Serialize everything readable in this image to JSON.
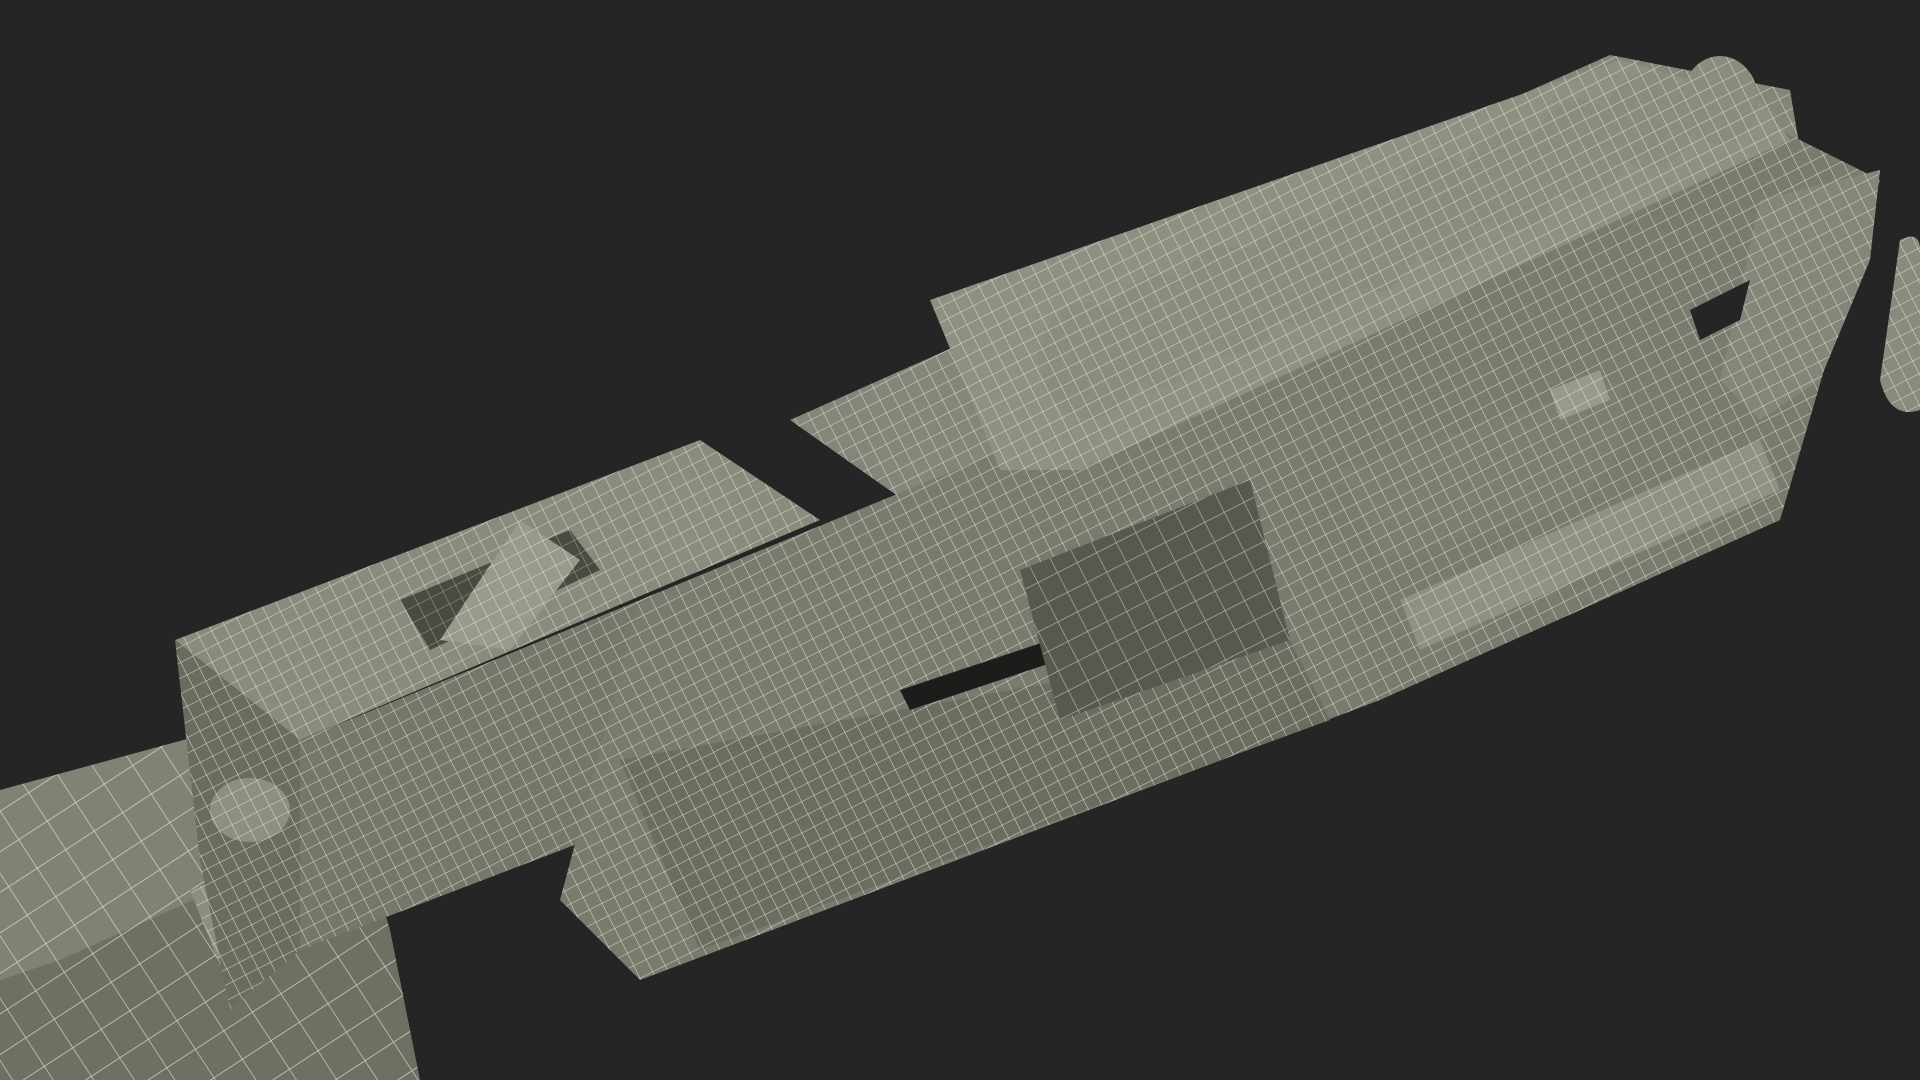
{
  "scene": {
    "subject": "wireframe-weapon-model",
    "background_color": "#252525",
    "mesh_fill_color": "#7f7f72",
    "mesh_shadow_color": "#55554c",
    "mesh_light_color": "#9a9a8c",
    "wire_color": "#e9e9dc",
    "slot_color": "#1c1c1a"
  }
}
